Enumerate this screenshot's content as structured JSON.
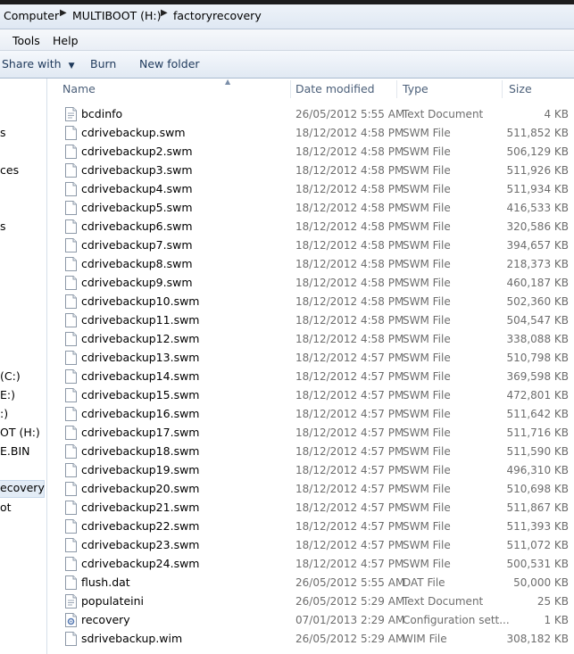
{
  "address": {
    "crumbs": [
      "Computer",
      "MULTIBOOT (H:)",
      "factoryrecovery"
    ]
  },
  "menu": {
    "tools": "Tools",
    "help": "Help"
  },
  "toolbar": {
    "share_with": "Share with",
    "burn": "Burn",
    "new_folder": "New folder"
  },
  "navpane": {
    "items": [
      {
        "label": "s"
      },
      {
        "label": "ces"
      },
      {
        "label": "s"
      },
      {
        "label": "(C:)"
      },
      {
        "label": "E:)"
      },
      {
        "label": ":)"
      },
      {
        "label": "OT (H:)"
      },
      {
        "label": "E.BIN"
      },
      {
        "label": "ecovery"
      },
      {
        "label": "ot"
      }
    ]
  },
  "columns": {
    "name": "Name",
    "date": "Date modified",
    "type": "Type",
    "size": "Size"
  },
  "files": [
    {
      "name": "bcdinfo",
      "date": "26/05/2012 5:55 AM",
      "type": "Text Document",
      "size": "4 KB",
      "icon": "text-file-icon"
    },
    {
      "name": "cdrivebackup.swm",
      "date": "18/12/2012 4:58 PM",
      "type": "SWM File",
      "size": "511,852 KB",
      "icon": "file-icon"
    },
    {
      "name": "cdrivebackup2.swm",
      "date": "18/12/2012 4:58 PM",
      "type": "SWM File",
      "size": "506,129 KB",
      "icon": "file-icon"
    },
    {
      "name": "cdrivebackup3.swm",
      "date": "18/12/2012 4:58 PM",
      "type": "SWM File",
      "size": "511,926 KB",
      "icon": "file-icon"
    },
    {
      "name": "cdrivebackup4.swm",
      "date": "18/12/2012 4:58 PM",
      "type": "SWM File",
      "size": "511,934 KB",
      "icon": "file-icon"
    },
    {
      "name": "cdrivebackup5.swm",
      "date": "18/12/2012 4:58 PM",
      "type": "SWM File",
      "size": "416,533 KB",
      "icon": "file-icon"
    },
    {
      "name": "cdrivebackup6.swm",
      "date": "18/12/2012 4:58 PM",
      "type": "SWM File",
      "size": "320,586 KB",
      "icon": "file-icon"
    },
    {
      "name": "cdrivebackup7.swm",
      "date": "18/12/2012 4:58 PM",
      "type": "SWM File",
      "size": "394,657 KB",
      "icon": "file-icon"
    },
    {
      "name": "cdrivebackup8.swm",
      "date": "18/12/2012 4:58 PM",
      "type": "SWM File",
      "size": "218,373 KB",
      "icon": "file-icon"
    },
    {
      "name": "cdrivebackup9.swm",
      "date": "18/12/2012 4:58 PM",
      "type": "SWM File",
      "size": "460,187 KB",
      "icon": "file-icon"
    },
    {
      "name": "cdrivebackup10.swm",
      "date": "18/12/2012 4:58 PM",
      "type": "SWM File",
      "size": "502,360 KB",
      "icon": "file-icon"
    },
    {
      "name": "cdrivebackup11.swm",
      "date": "18/12/2012 4:58 PM",
      "type": "SWM File",
      "size": "504,547 KB",
      "icon": "file-icon"
    },
    {
      "name": "cdrivebackup12.swm",
      "date": "18/12/2012 4:58 PM",
      "type": "SWM File",
      "size": "338,088 KB",
      "icon": "file-icon"
    },
    {
      "name": "cdrivebackup13.swm",
      "date": "18/12/2012 4:57 PM",
      "type": "SWM File",
      "size": "510,798 KB",
      "icon": "file-icon"
    },
    {
      "name": "cdrivebackup14.swm",
      "date": "18/12/2012 4:57 PM",
      "type": "SWM File",
      "size": "369,598 KB",
      "icon": "file-icon"
    },
    {
      "name": "cdrivebackup15.swm",
      "date": "18/12/2012 4:57 PM",
      "type": "SWM File",
      "size": "472,801 KB",
      "icon": "file-icon"
    },
    {
      "name": "cdrivebackup16.swm",
      "date": "18/12/2012 4:57 PM",
      "type": "SWM File",
      "size": "511,642 KB",
      "icon": "file-icon"
    },
    {
      "name": "cdrivebackup17.swm",
      "date": "18/12/2012 4:57 PM",
      "type": "SWM File",
      "size": "511,716 KB",
      "icon": "file-icon"
    },
    {
      "name": "cdrivebackup18.swm",
      "date": "18/12/2012 4:57 PM",
      "type": "SWM File",
      "size": "511,590 KB",
      "icon": "file-icon"
    },
    {
      "name": "cdrivebackup19.swm",
      "date": "18/12/2012 4:57 PM",
      "type": "SWM File",
      "size": "496,310 KB",
      "icon": "file-icon"
    },
    {
      "name": "cdrivebackup20.swm",
      "date": "18/12/2012 4:57 PM",
      "type": "SWM File",
      "size": "510,698 KB",
      "icon": "file-icon"
    },
    {
      "name": "cdrivebackup21.swm",
      "date": "18/12/2012 4:57 PM",
      "type": "SWM File",
      "size": "511,867 KB",
      "icon": "file-icon"
    },
    {
      "name": "cdrivebackup22.swm",
      "date": "18/12/2012 4:57 PM",
      "type": "SWM File",
      "size": "511,393 KB",
      "icon": "file-icon"
    },
    {
      "name": "cdrivebackup23.swm",
      "date": "18/12/2012 4:57 PM",
      "type": "SWM File",
      "size": "511,072 KB",
      "icon": "file-icon"
    },
    {
      "name": "cdrivebackup24.swm",
      "date": "18/12/2012 4:57 PM",
      "type": "SWM File",
      "size": "500,531 KB",
      "icon": "file-icon"
    },
    {
      "name": "flush.dat",
      "date": "26/05/2012 5:55 AM",
      "type": "DAT File",
      "size": "50,000 KB",
      "icon": "file-icon"
    },
    {
      "name": "populateini",
      "date": "26/05/2012 5:29 AM",
      "type": "Text Document",
      "size": "25 KB",
      "icon": "text-file-icon"
    },
    {
      "name": "recovery",
      "date": "07/01/2013 2:29 AM",
      "type": "Configuration sett...",
      "size": "1 KB",
      "icon": "config-file-icon"
    },
    {
      "name": "sdrivebackup.wim",
      "date": "26/05/2012 5:29 AM",
      "type": "WIM File",
      "size": "308,182 KB",
      "icon": "file-icon"
    }
  ],
  "colors": {
    "toolbar_text": "#1e395b",
    "header_text": "#4c607a",
    "detail_text": "#6d6d6d"
  }
}
